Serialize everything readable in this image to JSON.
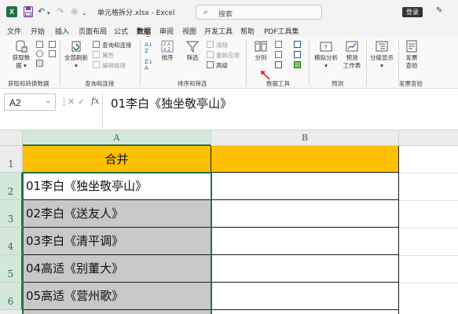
{
  "titlebar": {
    "filename": "单元格拆分.xlsx",
    "app_name": "Excel",
    "separator": "-",
    "search_placeholder": "搜索",
    "login_label": "登录"
  },
  "menu": {
    "tabs": [
      "文件",
      "开始",
      "插入",
      "页面布局",
      "公式",
      "数据",
      "审阅",
      "视图",
      "开发工具",
      "帮助",
      "PDF工具集"
    ],
    "active_index": 5
  },
  "ribbon": {
    "groups": [
      {
        "label": "获取和转换数据",
        "buttons": [
          {
            "label_line1": "获取数",
            "label_line2": "据 ▾"
          }
        ]
      },
      {
        "label": "查询和连接",
        "big": {
          "label_line1": "全部刷新",
          "label_line2": "▾"
        },
        "small": [
          "查询和连接",
          "属性",
          "编辑链接"
        ]
      },
      {
        "label": "排序和筛选",
        "big": [
          {
            "label": "排序"
          },
          {
            "label": "筛选"
          }
        ],
        "small": [
          "清除",
          "重新应用",
          "高级"
        ]
      },
      {
        "label": "数据工具",
        "big": {
          "label": "分列"
        }
      },
      {
        "label": "预测",
        "buttons": [
          {
            "label_line1": "模拟分析",
            "label_line2": "▾"
          },
          {
            "label_line1": "预测",
            "label_line2": "工作表"
          }
        ]
      },
      {
        "label": "",
        "buttons": [
          {
            "label_line1": "分级显示",
            "label_line2": "▾"
          }
        ]
      },
      {
        "label": "发票查验",
        "buttons": [
          {
            "label_line1": "发票",
            "label_line2": "查验"
          }
        ]
      }
    ]
  },
  "formula_bar": {
    "name_box": "A2",
    "fx_label": "fx",
    "content": "01李白《独坐敬亭山》"
  },
  "sheet": {
    "columns": [
      "A",
      "B"
    ],
    "selected_column": "A",
    "rows": [
      {
        "num": "1",
        "a": "合并",
        "b": ""
      },
      {
        "num": "2",
        "a": "01李白《独坐敬亭山》",
        "b": ""
      },
      {
        "num": "3",
        "a": "02李白《送友人》",
        "b": ""
      },
      {
        "num": "4",
        "a": "03李白《清平调》",
        "b": ""
      },
      {
        "num": "5",
        "a": "04高适《别董大》",
        "b": ""
      },
      {
        "num": "6",
        "a": "05高适《营州歌》",
        "b": ""
      }
    ],
    "colors": {
      "header_fill": "#ffc000",
      "shaded_fill": "#c8c8c8",
      "accent": "#217346"
    }
  }
}
